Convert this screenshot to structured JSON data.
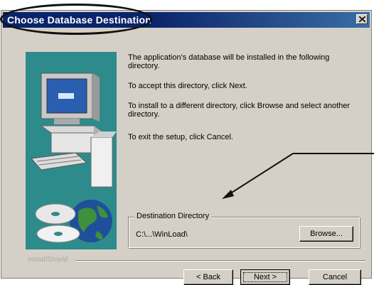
{
  "window": {
    "title": "Choose Database Destination"
  },
  "content": {
    "line1": "The application's database will be installed in the following directory.",
    "line2": "To accept this directory, click Next.",
    "line3": "To install to a different directory, click Browse and select another directory.",
    "line4": "To exit the setup,  click Cancel."
  },
  "destination": {
    "group_label": "Destination Directory",
    "path": "C:\\...\\WinLoad\\",
    "browse_label": "Browse..."
  },
  "footer": {
    "brand": "InstallShield",
    "back_label": "< Back",
    "next_label": "Next >",
    "cancel_label": "Cancel"
  },
  "icons": [
    "close-icon",
    "computer-illustration",
    "globe-icon",
    "cd-disc-icon",
    "arrow-annotation"
  ],
  "colors": {
    "titlebar": "#0a246a",
    "panel_bg": "#d4d0c8",
    "art_bg": "#2e8b8b"
  }
}
